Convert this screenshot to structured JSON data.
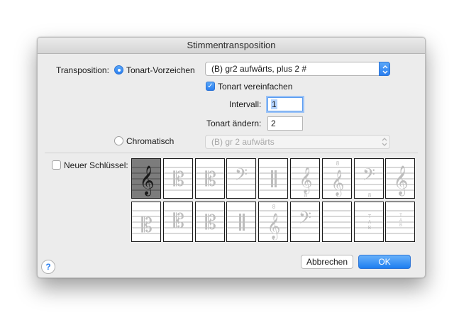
{
  "dialog": {
    "title": "Stimmentransposition"
  },
  "transposition": {
    "label": "Transposition:",
    "key_signature_option": {
      "label": "Tonart-Vorzeichen",
      "selected": true
    },
    "key_popup": {
      "value": "(B) gr2 aufwärts, plus 2 #"
    },
    "simplify_key": {
      "label": "Tonart vereinfachen",
      "checked": true
    },
    "interval": {
      "label": "Intervall:",
      "value": "1"
    },
    "change_key": {
      "label": "Tonart ändern:",
      "value": "2"
    },
    "chromatic_option": {
      "label": "Chromatisch",
      "selected": false
    },
    "chromatic_popup": {
      "value": "(B) gr 2 aufwärts"
    }
  },
  "new_clef": {
    "label": "Neuer Schlüssel:",
    "checked": false,
    "selected_index": 0,
    "clefs": [
      "treble-clef",
      "alto-clef",
      "alto-clef",
      "bass-clef",
      "percussion-clef",
      "treble-8vb-clef",
      "treble-8va-clef",
      "bass-clef-low",
      "treble-clef",
      "soprano-clef",
      "tenor-clef",
      "baritone-c-clef",
      "percussion-clef",
      "treble-8va-clef",
      "bass-clef",
      "blank-clef",
      "tab-clef",
      "tab-clef-small"
    ]
  },
  "buttons": {
    "cancel": "Abbrechen",
    "ok": "OK",
    "help": "?"
  },
  "colors": {
    "accent": "#2b7ff0",
    "selected_clef_bg": "#7c7c7c"
  }
}
